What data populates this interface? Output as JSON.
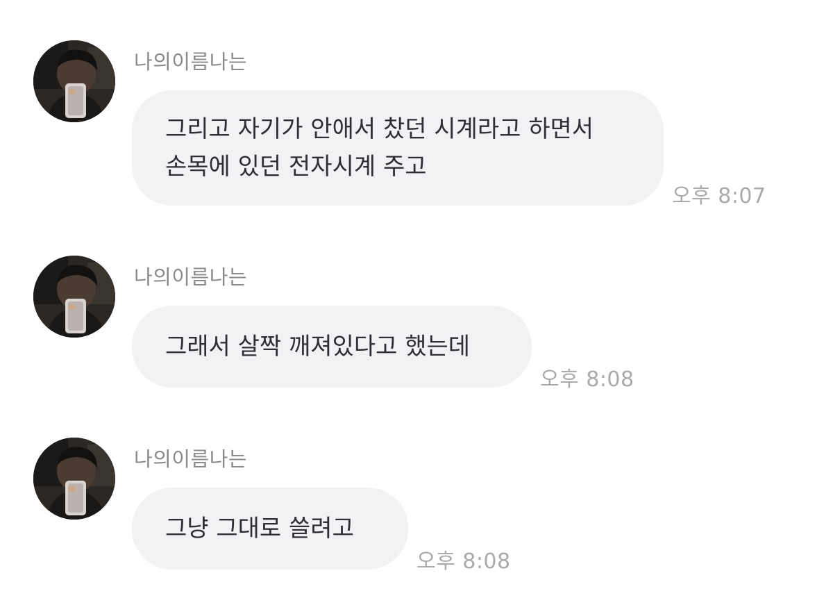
{
  "messages": [
    {
      "sender": "나의이름나는",
      "lines": [
        "그리고 자기가 안애서 찼던 시계라고 하면서",
        "손목에 있던 전자시계 주고"
      ],
      "time": "오후 8:07"
    },
    {
      "sender": "나의이름나는",
      "lines": [
        "그래서 살짝 깨져있다고 했는데"
      ],
      "time": "오후 8:08"
    },
    {
      "sender": "나의이름나는",
      "lines": [
        "그냥 그대로 쓸려고"
      ],
      "time": "오후 8:08"
    }
  ],
  "colors": {
    "bubble": "#f2f2f5",
    "text": "#2f2f33",
    "sender": "#8a8a8e",
    "timestamp": "#a9a9ae"
  },
  "icons": {
    "avatar": "profile-photo-avatar"
  }
}
